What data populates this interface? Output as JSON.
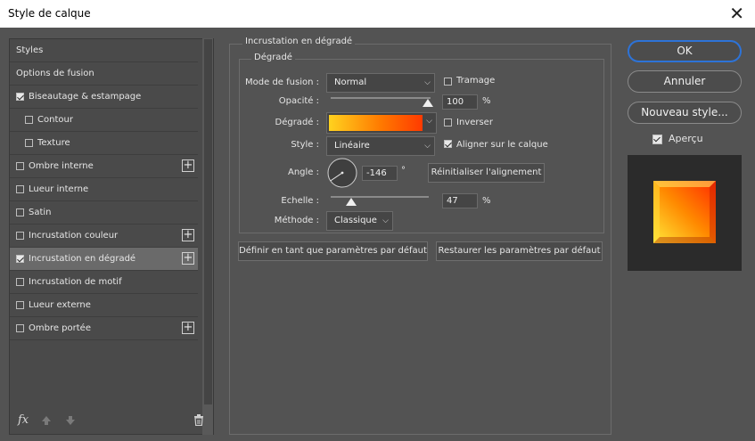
{
  "window": {
    "title": "Style de calque",
    "close_label": "✕"
  },
  "sidebar": {
    "items": [
      {
        "label": "Styles"
      },
      {
        "label": "Options de fusion"
      },
      {
        "label": "Biseautage & estampage"
      },
      {
        "label": "Contour"
      },
      {
        "label": "Texture"
      },
      {
        "label": "Ombre interne"
      },
      {
        "label": "Lueur interne"
      },
      {
        "label": "Satin"
      },
      {
        "label": "Incrustation couleur"
      },
      {
        "label": "Incrustation en dégradé"
      },
      {
        "label": "Incrustation de motif"
      },
      {
        "label": "Lueur externe"
      },
      {
        "label": "Ombre portée"
      }
    ],
    "plus_label": "+",
    "fx_label": "fx"
  },
  "panel": {
    "title": "Incrustation en dégradé",
    "group_title": "Dégradé",
    "blend_mode_label": "Mode de fusion :",
    "blend_mode_value": "Normal",
    "dither_label": "Tramage",
    "opacity_label": "Opacité :",
    "opacity_value": "100",
    "opacity_unit": "%",
    "opacity_fraction": 1.0,
    "gradient_label": "Dégradé :",
    "reverse_label": "Inverser",
    "style_label": "Style :",
    "style_value": "Linéaire",
    "align_label": "Aligner sur le calque",
    "angle_label": "Angle :",
    "angle_value": "-146",
    "angle_unit": "°",
    "reset_align_label": "Réinitialiser l'alignement",
    "scale_label": "Echelle :",
    "scale_value": "47",
    "scale_unit": "%",
    "scale_fraction": 0.19,
    "method_label": "Méthode :",
    "method_value": "Classique",
    "default_label": "Définir en tant que paramètres par défaut",
    "restore_label": "Restaurer les paramètres par défaut"
  },
  "actions": {
    "ok": "OK",
    "cancel": "Annuler",
    "new_style": "Nouveau style...",
    "preview_label": "Aperçu"
  },
  "colors": {
    "gradient_start": "#ffd21f",
    "gradient_end": "#ff3a00",
    "accent": "#2d73d8"
  }
}
